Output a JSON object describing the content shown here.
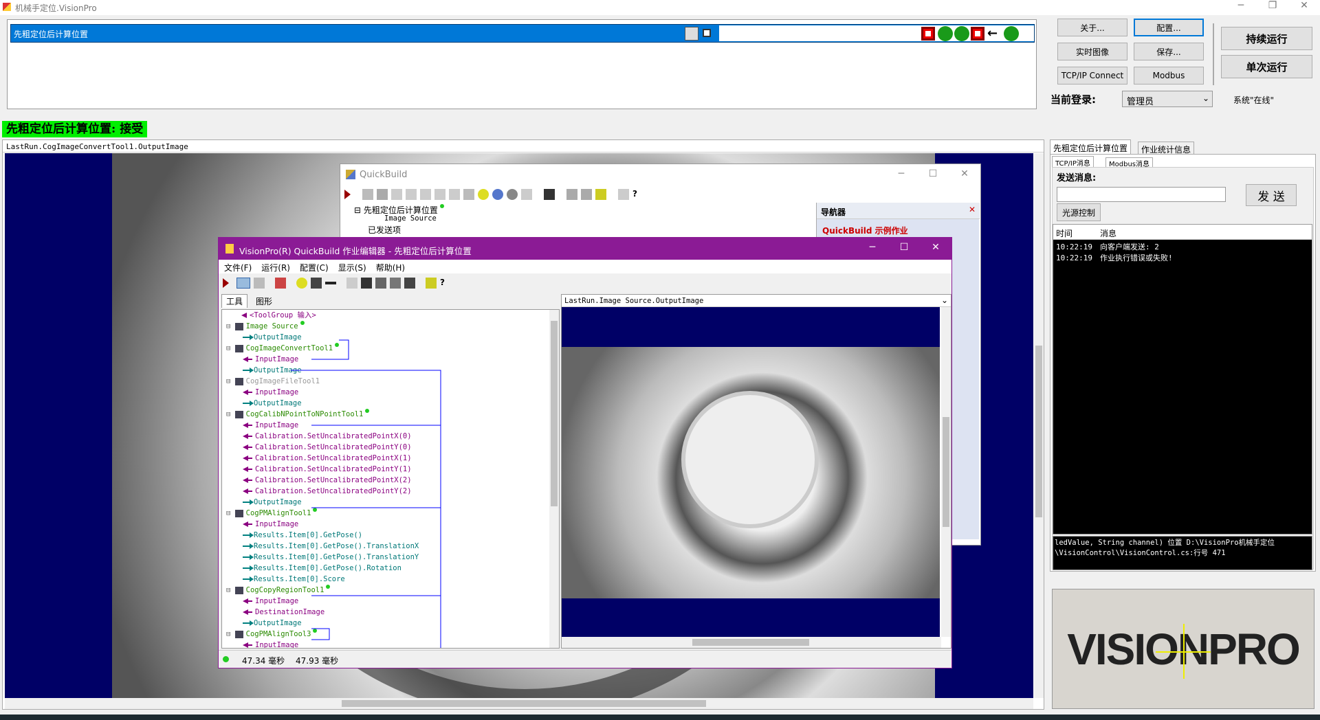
{
  "app": {
    "title": "机械手定位.VisionPro"
  },
  "job": {
    "name": "先粗定位后计算位置",
    "status_text": "先粗定位后计算位置: 接受"
  },
  "buttons": {
    "about": "关于...",
    "config": "配置...",
    "live": "实时图像",
    "save": "保存...",
    "tcp": "TCP/IP Connect",
    "modbus": "Modbus",
    "run_cont": "持续运行",
    "run_once": "单次运行"
  },
  "login": {
    "label": "当前登录:",
    "user": "管理员",
    "system_status": "系统\"在线\""
  },
  "display": {
    "caption": "LastRun.CogImageConvertTool1.OutputImage"
  },
  "right_panel": {
    "tabs": [
      "先粗定位后计算位置",
      "作业统计信息"
    ],
    "subtabs": [
      "TCP/IP消息",
      "Modbus消息"
    ],
    "send_label": "发送消息:",
    "send_value": "",
    "send_button": "发 送",
    "light_button": "光源控制",
    "table_headers": [
      "时间",
      "消息"
    ],
    "messages": [
      {
        "time": "10:22:19",
        "text": "向客户端发送: 2"
      },
      {
        "time": "10:22:19",
        "text": "作业执行错误或失败!"
      }
    ],
    "error_text": "ledValue, String channel) 位置 D:\\VisionPro机械手定位\\VisionControl\\VisionControl.cs:行号 471",
    "logo": "VISIONPRO"
  },
  "quickbuild": {
    "title": "QuickBuild",
    "tree": [
      "先粗定位后计算位置",
      "Image Source",
      "已发送项"
    ],
    "nav_title": "导航器",
    "nav_link": "QuickBuild 示例作业"
  },
  "editor": {
    "title": "VisionPro(R) QuickBuild 作业编辑器 - 先粗定位后计算位置",
    "menu": [
      "文件(F)",
      "运行(R)",
      "配置(C)",
      "显示(S)",
      "帮助(H)"
    ],
    "tabs": [
      "工具",
      "图形"
    ],
    "image_caption": "LastRun.Image Source.OutputImage",
    "status_times": [
      "47.34 毫秒",
      "47.93 毫秒"
    ],
    "tree": [
      {
        "text": "<ToolGroup 输入>",
        "kind": "in",
        "indent": 0
      },
      {
        "text": "Image Source",
        "kind": "tool",
        "indent": 1
      },
      {
        "text": "OutputImage",
        "kind": "out",
        "indent": 2
      },
      {
        "text": "CogImageConvertTool1",
        "kind": "tool",
        "indent": 1
      },
      {
        "text": "InputImage",
        "kind": "in",
        "indent": 2
      },
      {
        "text": "OutputImage",
        "kind": "out",
        "indent": 2
      },
      {
        "text": "CogImageFileTool1",
        "kind": "tooldis",
        "indent": 1
      },
      {
        "text": "InputImage",
        "kind": "in",
        "indent": 2
      },
      {
        "text": "OutputImage",
        "kind": "out",
        "indent": 2
      },
      {
        "text": "CogCalibNPointToNPointTool1",
        "kind": "tool",
        "indent": 1
      },
      {
        "text": "InputImage",
        "kind": "in",
        "indent": 2
      },
      {
        "text": "Calibration.SetUncalibratedPointX(0)",
        "kind": "in",
        "indent": 2
      },
      {
        "text": "Calibration.SetUncalibratedPointY(0)",
        "kind": "in",
        "indent": 2
      },
      {
        "text": "Calibration.SetUncalibratedPointX(1)",
        "kind": "in",
        "indent": 2
      },
      {
        "text": "Calibration.SetUncalibratedPointY(1)",
        "kind": "in",
        "indent": 2
      },
      {
        "text": "Calibration.SetUncalibratedPointX(2)",
        "kind": "in",
        "indent": 2
      },
      {
        "text": "Calibration.SetUncalibratedPointY(2)",
        "kind": "in",
        "indent": 2
      },
      {
        "text": "OutputImage",
        "kind": "out",
        "indent": 2
      },
      {
        "text": "CogPMAlignTool1",
        "kind": "tool",
        "indent": 1
      },
      {
        "text": "InputImage",
        "kind": "in",
        "indent": 2
      },
      {
        "text": "Results.Item[0].GetPose()",
        "kind": "out",
        "indent": 2
      },
      {
        "text": "Results.Item[0].GetPose().TranslationX",
        "kind": "out",
        "indent": 2
      },
      {
        "text": "Results.Item[0].GetPose().TranslationY",
        "kind": "out",
        "indent": 2
      },
      {
        "text": "Results.Item[0].GetPose().Rotation",
        "kind": "out",
        "indent": 2
      },
      {
        "text": "Results.Item[0].Score",
        "kind": "out",
        "indent": 2
      },
      {
        "text": "CogCopyRegionTool1",
        "kind": "tool",
        "indent": 1
      },
      {
        "text": "InputImage",
        "kind": "in",
        "indent": 2
      },
      {
        "text": "DestinationImage",
        "kind": "in",
        "indent": 2
      },
      {
        "text": "OutputImage",
        "kind": "out",
        "indent": 2
      },
      {
        "text": "CogPMAlignTool3",
        "kind": "tool",
        "indent": 1
      },
      {
        "text": "InputImage",
        "kind": "in",
        "indent": 2
      }
    ]
  },
  "colors": {
    "accent": "#0078d7",
    "editor_title": "#8b1b95",
    "status_green": "#00ee00",
    "display_bg": "#000066"
  }
}
